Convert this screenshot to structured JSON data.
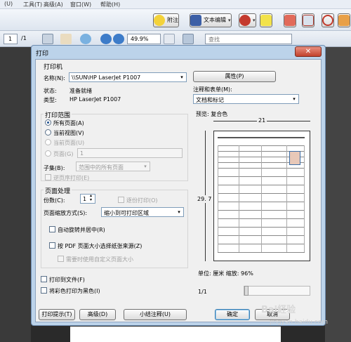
{
  "menubar": {
    "items": [
      "(U)",
      "工具(T)",
      "高级(A)",
      "窗口(W)",
      "帮助(H)"
    ]
  },
  "toolbar1": {
    "attach_label": "附注",
    "text_edit_label": "文本编辑"
  },
  "toolbar2": {
    "page_current": "1",
    "page_total": "/1",
    "zoom": "49.9%",
    "search_placeholder": "查找"
  },
  "dialog": {
    "title": "打印",
    "close_symbol": "✕",
    "printer": {
      "group_label": "打印机",
      "name_label": "名称(N):",
      "name_value": "\\\\SUN\\HP LaserJet P1007",
      "status_label": "状态:",
      "status_value": "准备就绪",
      "type_label": "类型:",
      "type_value": "HP LaserJet P1007",
      "properties_button": "属性(P)",
      "comments_label": "注释和表单(M):",
      "comments_value": "文档和标记"
    },
    "range": {
      "group_label": "打印范围",
      "all_pages": "所有页面(A)",
      "current_view": "当前视图(V)",
      "current_page": "当前页面(U)",
      "pages_label": "页面(G)",
      "pages_value": "1",
      "subset_label": "子集(B):",
      "subset_value": "范围中的所有页面",
      "reverse_label": "逆页序打印(E)"
    },
    "handling": {
      "group_label": "页面处理",
      "copies_label": "份数(C):",
      "copies_value": "1",
      "collate_label": "逐份打印(O)",
      "scaling_label": "页面缩放方式(S):",
      "scaling_value": "缩小到可打印区域",
      "autorotate_label": "自动旋转并居中(R)",
      "pdf_paper_label": "按 PDF 页面大小选择纸张来源(Z)",
      "custom_paper_label": "需要时使用自定义页面大小"
    },
    "print_to_file_label": "打印到文件(F)",
    "grayscale_label": "将彩色打印为黑色(I)",
    "preview": {
      "label": "预览: 复合色",
      "width_value": "21",
      "height_value": "29. 7",
      "units_text": "单位: 厘米 缩放: 96%",
      "page_counter": "1/1"
    },
    "buttons": {
      "print_tips": "打印提示(T)",
      "advanced": "高级(D)",
      "summarize": "小结注释(U)",
      "ok": "确定",
      "cancel": "取消"
    }
  },
  "watermark": {
    "brand": "Bai経验",
    "url": "jingyan.baidu.com"
  }
}
